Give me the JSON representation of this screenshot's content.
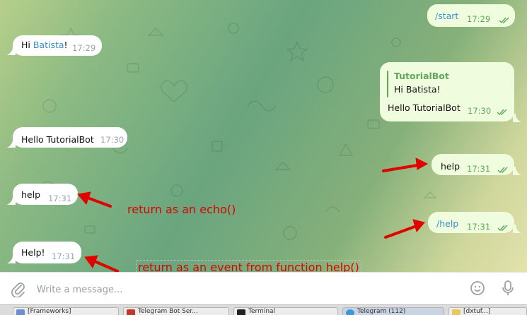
{
  "messages": {
    "start": {
      "text": "/start",
      "time": "17:29"
    },
    "greeting": {
      "pre": "Hi ",
      "name": "Batista",
      "post": "!",
      "time": "17:29"
    },
    "bot_reply": {
      "quote_name": "TutorialBot",
      "quote_text": "Hi Batista!",
      "text": "Hello TutorialBot",
      "time": "17:30"
    },
    "hello": {
      "text": "Hello TutorialBot",
      "time": "17:30"
    },
    "help_out": {
      "text": "help",
      "time": "17:31"
    },
    "help_in": {
      "text": "help",
      "time": "17:31"
    },
    "help_cmd": {
      "text": "/help",
      "time": "17:31"
    },
    "help_reply": {
      "text": "Help!",
      "time": "17:31"
    }
  },
  "annotations": {
    "echo": "return as an echo()",
    "event": "return as an event from function help()",
    "color": "#e10000"
  },
  "composer": {
    "placeholder": "Write a message...",
    "attach_icon": "paperclip-icon",
    "emoji_icon": "smiley-icon",
    "mic_icon": "microphone-icon"
  },
  "taskbar": {
    "items": [
      {
        "label": "[Frameworks]",
        "icon_color": "#6b8fd6"
      },
      {
        "label": "Telegram Bot Ser...",
        "icon_color": "#c0392b"
      },
      {
        "label": "Terminal",
        "icon_color": "#222222"
      },
      {
        "label": "Telegram (112)",
        "icon_color": "#3a9ad9"
      },
      {
        "label": "[dxtuf...]",
        "icon_color": "#e8c95a"
      }
    ]
  }
}
